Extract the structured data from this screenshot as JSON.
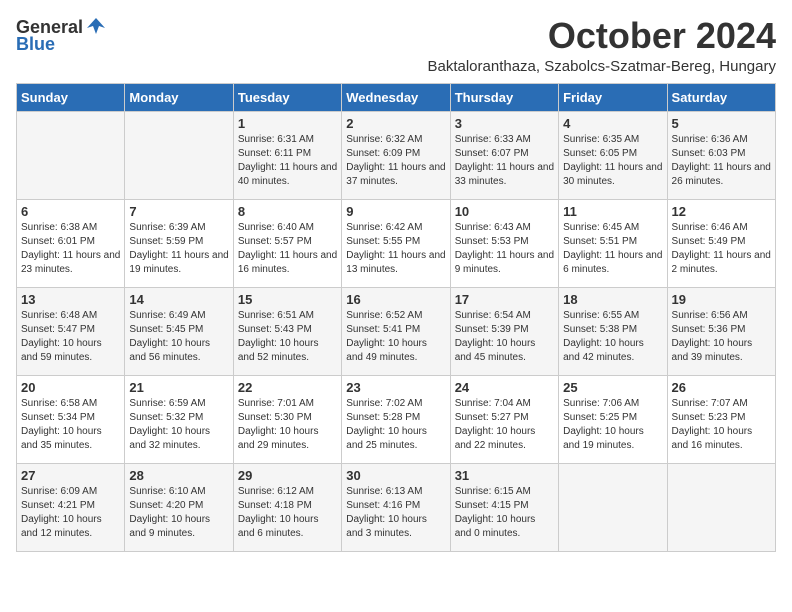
{
  "header": {
    "logo_general": "General",
    "logo_blue": "Blue",
    "month_title": "October 2024",
    "subtitle": "Baktaloranthaza, Szabolcs-Szatmar-Bereg, Hungary"
  },
  "columns": [
    "Sunday",
    "Monday",
    "Tuesday",
    "Wednesday",
    "Thursday",
    "Friday",
    "Saturday"
  ],
  "weeks": [
    [
      {
        "day": "",
        "info": ""
      },
      {
        "day": "",
        "info": ""
      },
      {
        "day": "1",
        "info": "Sunrise: 6:31 AM\nSunset: 6:11 PM\nDaylight: 11 hours and 40 minutes."
      },
      {
        "day": "2",
        "info": "Sunrise: 6:32 AM\nSunset: 6:09 PM\nDaylight: 11 hours and 37 minutes."
      },
      {
        "day": "3",
        "info": "Sunrise: 6:33 AM\nSunset: 6:07 PM\nDaylight: 11 hours and 33 minutes."
      },
      {
        "day": "4",
        "info": "Sunrise: 6:35 AM\nSunset: 6:05 PM\nDaylight: 11 hours and 30 minutes."
      },
      {
        "day": "5",
        "info": "Sunrise: 6:36 AM\nSunset: 6:03 PM\nDaylight: 11 hours and 26 minutes."
      }
    ],
    [
      {
        "day": "6",
        "info": "Sunrise: 6:38 AM\nSunset: 6:01 PM\nDaylight: 11 hours and 23 minutes."
      },
      {
        "day": "7",
        "info": "Sunrise: 6:39 AM\nSunset: 5:59 PM\nDaylight: 11 hours and 19 minutes."
      },
      {
        "day": "8",
        "info": "Sunrise: 6:40 AM\nSunset: 5:57 PM\nDaylight: 11 hours and 16 minutes."
      },
      {
        "day": "9",
        "info": "Sunrise: 6:42 AM\nSunset: 5:55 PM\nDaylight: 11 hours and 13 minutes."
      },
      {
        "day": "10",
        "info": "Sunrise: 6:43 AM\nSunset: 5:53 PM\nDaylight: 11 hours and 9 minutes."
      },
      {
        "day": "11",
        "info": "Sunrise: 6:45 AM\nSunset: 5:51 PM\nDaylight: 11 hours and 6 minutes."
      },
      {
        "day": "12",
        "info": "Sunrise: 6:46 AM\nSunset: 5:49 PM\nDaylight: 11 hours and 2 minutes."
      }
    ],
    [
      {
        "day": "13",
        "info": "Sunrise: 6:48 AM\nSunset: 5:47 PM\nDaylight: 10 hours and 59 minutes."
      },
      {
        "day": "14",
        "info": "Sunrise: 6:49 AM\nSunset: 5:45 PM\nDaylight: 10 hours and 56 minutes."
      },
      {
        "day": "15",
        "info": "Sunrise: 6:51 AM\nSunset: 5:43 PM\nDaylight: 10 hours and 52 minutes."
      },
      {
        "day": "16",
        "info": "Sunrise: 6:52 AM\nSunset: 5:41 PM\nDaylight: 10 hours and 49 minutes."
      },
      {
        "day": "17",
        "info": "Sunrise: 6:54 AM\nSunset: 5:39 PM\nDaylight: 10 hours and 45 minutes."
      },
      {
        "day": "18",
        "info": "Sunrise: 6:55 AM\nSunset: 5:38 PM\nDaylight: 10 hours and 42 minutes."
      },
      {
        "day": "19",
        "info": "Sunrise: 6:56 AM\nSunset: 5:36 PM\nDaylight: 10 hours and 39 minutes."
      }
    ],
    [
      {
        "day": "20",
        "info": "Sunrise: 6:58 AM\nSunset: 5:34 PM\nDaylight: 10 hours and 35 minutes."
      },
      {
        "day": "21",
        "info": "Sunrise: 6:59 AM\nSunset: 5:32 PM\nDaylight: 10 hours and 32 minutes."
      },
      {
        "day": "22",
        "info": "Sunrise: 7:01 AM\nSunset: 5:30 PM\nDaylight: 10 hours and 29 minutes."
      },
      {
        "day": "23",
        "info": "Sunrise: 7:02 AM\nSunset: 5:28 PM\nDaylight: 10 hours and 25 minutes."
      },
      {
        "day": "24",
        "info": "Sunrise: 7:04 AM\nSunset: 5:27 PM\nDaylight: 10 hours and 22 minutes."
      },
      {
        "day": "25",
        "info": "Sunrise: 7:06 AM\nSunset: 5:25 PM\nDaylight: 10 hours and 19 minutes."
      },
      {
        "day": "26",
        "info": "Sunrise: 7:07 AM\nSunset: 5:23 PM\nDaylight: 10 hours and 16 minutes."
      }
    ],
    [
      {
        "day": "27",
        "info": "Sunrise: 6:09 AM\nSunset: 4:21 PM\nDaylight: 10 hours and 12 minutes."
      },
      {
        "day": "28",
        "info": "Sunrise: 6:10 AM\nSunset: 4:20 PM\nDaylight: 10 hours and 9 minutes."
      },
      {
        "day": "29",
        "info": "Sunrise: 6:12 AM\nSunset: 4:18 PM\nDaylight: 10 hours and 6 minutes."
      },
      {
        "day": "30",
        "info": "Sunrise: 6:13 AM\nSunset: 4:16 PM\nDaylight: 10 hours and 3 minutes."
      },
      {
        "day": "31",
        "info": "Sunrise: 6:15 AM\nSunset: 4:15 PM\nDaylight: 10 hours and 0 minutes."
      },
      {
        "day": "",
        "info": ""
      },
      {
        "day": "",
        "info": ""
      }
    ]
  ]
}
